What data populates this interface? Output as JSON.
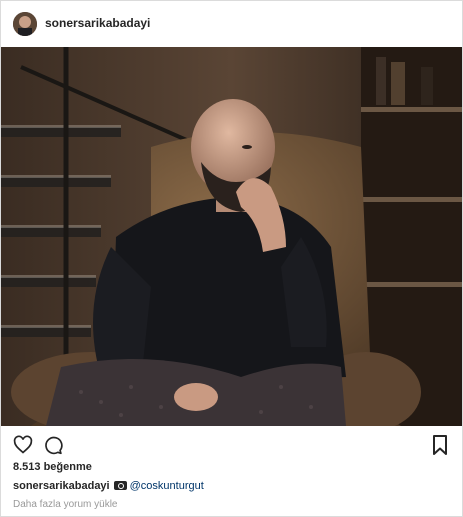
{
  "post": {
    "username": "sonersarikabadayi",
    "likes_text": "8.513 beğenme",
    "caption_user": "sonersarikabadayi",
    "caption_mention": "@coskunturgut",
    "load_more": "Daha fazla yorum yükle",
    "photo_subject": "bald bearded man in black shirt seated in a leather armchair, hand on chin",
    "icons": [
      "heart-icon",
      "comment-icon",
      "bookmark-icon",
      "camera-icon"
    ]
  }
}
